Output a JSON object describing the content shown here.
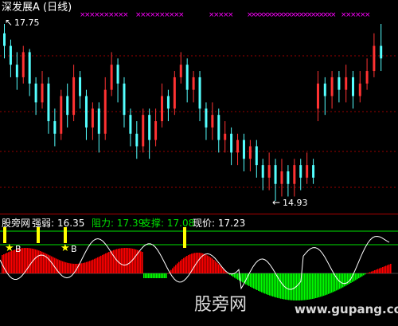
{
  "header": {
    "title": "深发展A",
    "period": "(日线)",
    "max_label": "17.75",
    "min_label": "14.93"
  },
  "indicator_bar": {
    "site_label": "股旁网",
    "strength_label": "强弱:",
    "strength_value": "16.35",
    "resistance_text": "阻力: 17.39",
    "support_text": "支撑: 17.08",
    "price_text": "现价: 17.23",
    "buy_marker": "B"
  },
  "watermark": {
    "text": "股旁网",
    "url": "www.gupang.com"
  },
  "colors": {
    "background": "#000000",
    "up": "#ff3232",
    "down": "#54ffff",
    "grid": "#990000",
    "signal_x": "#ff00ff",
    "strength_line": "#ffffff",
    "resistance_line": "#00e000",
    "support_line": "#ffff00",
    "hist_pos": "#ff0000",
    "hist_neg": "#00ff00",
    "marker": "#ffff00"
  },
  "chart_data": {
    "type": "candlestick",
    "price_high": 17.75,
    "price_low": 14.93,
    "candles": [
      [
        17.6,
        17.4,
        17.75,
        17.2
      ],
      [
        17.4,
        17.1,
        17.5,
        16.9
      ],
      [
        17.1,
        16.9,
        17.3,
        16.7
      ],
      [
        16.9,
        17.3,
        17.4,
        16.8
      ],
      [
        17.3,
        16.8,
        17.35,
        16.6
      ],
      [
        16.8,
        16.5,
        16.9,
        16.3
      ],
      [
        16.5,
        16.8,
        17.0,
        16.4
      ],
      [
        16.8,
        16.2,
        16.9,
        16.0
      ],
      [
        16.2,
        16.0,
        16.4,
        15.8
      ],
      [
        16.0,
        16.6,
        16.7,
        15.9
      ],
      [
        16.6,
        16.3,
        16.8,
        16.1
      ],
      [
        16.3,
        16.9,
        17.1,
        16.2
      ],
      [
        16.9,
        16.6,
        17.0,
        16.4
      ],
      [
        16.6,
        16.1,
        16.7,
        15.9
      ],
      [
        16.1,
        16.4,
        16.5,
        15.9
      ],
      [
        16.4,
        16.0,
        16.5,
        15.7
      ],
      [
        16.0,
        16.7,
        16.9,
        15.9
      ],
      [
        16.7,
        17.1,
        17.3,
        16.6
      ],
      [
        17.1,
        16.8,
        17.2,
        16.5
      ],
      [
        16.8,
        16.3,
        16.9,
        16.1
      ],
      [
        16.3,
        16.0,
        16.4,
        15.8
      ],
      [
        16.0,
        15.8,
        16.2,
        15.6
      ],
      [
        15.8,
        16.3,
        16.4,
        15.7
      ],
      [
        16.3,
        15.9,
        16.4,
        15.6
      ],
      [
        15.9,
        16.2,
        16.4,
        15.8
      ],
      [
        16.2,
        16.6,
        16.8,
        16.1
      ],
      [
        16.6,
        16.4,
        16.7,
        16.2
      ],
      [
        16.4,
        16.9,
        17.0,
        16.3
      ],
      [
        16.9,
        17.1,
        17.3,
        16.8
      ],
      [
        17.1,
        16.7,
        17.2,
        16.5
      ],
      [
        16.7,
        16.9,
        17.0,
        16.5
      ],
      [
        16.9,
        16.4,
        17.0,
        16.2
      ],
      [
        16.4,
        16.1,
        16.5,
        15.9
      ],
      [
        16.1,
        16.3,
        16.5,
        15.9
      ],
      [
        16.3,
        15.9,
        16.4,
        15.7
      ],
      [
        15.9,
        16.0,
        16.2,
        15.7
      ],
      [
        16.0,
        15.7,
        16.1,
        15.5
      ],
      [
        15.7,
        15.9,
        16.0,
        15.5
      ],
      [
        15.9,
        15.6,
        16.0,
        15.4
      ],
      [
        15.6,
        15.8,
        15.9,
        15.4
      ],
      [
        15.8,
        15.5,
        15.9,
        15.3
      ],
      [
        15.5,
        15.3,
        15.6,
        15.1
      ],
      [
        15.3,
        15.5,
        15.7,
        15.1
      ],
      [
        15.5,
        15.2,
        15.6,
        14.93
      ],
      [
        15.2,
        15.4,
        15.6,
        15.0
      ],
      [
        15.4,
        15.2,
        15.5,
        15.0
      ],
      [
        15.2,
        15.5,
        15.6,
        15.0
      ],
      [
        15.5,
        15.3,
        15.6,
        15.1
      ],
      [
        15.3,
        15.5,
        15.7,
        15.2
      ],
      [
        15.5,
        15.3,
        15.6,
        15.2
      ],
      [
        16.4,
        16.8,
        17.0,
        16.2
      ],
      [
        16.8,
        16.6,
        16.9,
        16.3
      ],
      [
        16.6,
        16.9,
        17.0,
        16.4
      ],
      [
        16.9,
        16.7,
        17.0,
        16.5
      ],
      [
        16.7,
        16.9,
        17.1,
        16.5
      ],
      [
        16.9,
        16.6,
        17.0,
        16.4
      ],
      [
        16.6,
        16.8,
        17.0,
        16.5
      ],
      [
        16.8,
        17.0,
        17.2,
        16.7
      ],
      [
        17.0,
        17.4,
        17.6,
        16.9
      ],
      [
        17.4,
        17.2,
        17.75,
        17.0
      ]
    ]
  }
}
